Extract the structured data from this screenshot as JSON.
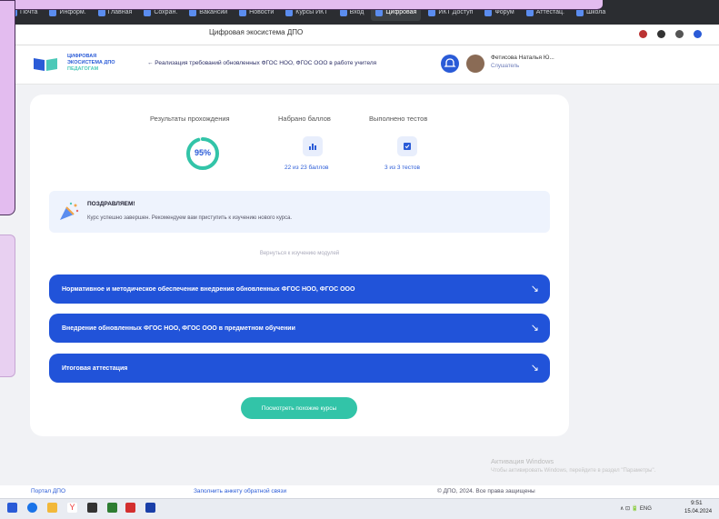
{
  "browser": {
    "tabs": [
      {
        "label": "Почта"
      },
      {
        "label": "Информ."
      },
      {
        "label": "Главная"
      },
      {
        "label": "Сохран."
      },
      {
        "label": "Вакансии"
      },
      {
        "label": "Новости"
      },
      {
        "label": "Курсы ИКТ"
      },
      {
        "label": "Вход"
      },
      {
        "label": "Цифровая",
        "active": true
      },
      {
        "label": "ИКТ Доступ"
      },
      {
        "label": "Форум"
      },
      {
        "label": "Аттестац."
      },
      {
        "label": "Школа"
      }
    ],
    "page_title": "Цифровая экосистема ДПО"
  },
  "header": {
    "logo_line1": "ЦИФРОВАЯ",
    "logo_line2": "ЭКОСИСТЕМА ДПО",
    "logo_line3": "ПЕДАГОГАМ",
    "back_link": "← Реализация требований обновленных ФГОС НОО, ФГОС ООО в работе учителя",
    "user_name": "Фетисова Наталья Ю...",
    "user_role": "Слушатель"
  },
  "results": {
    "col1_label": "Результаты прохождения",
    "col2_label": "Набрано баллов",
    "col3_label": "Выполнено тестов",
    "score_percent": 95,
    "score_text": "95%",
    "points_text": "22 из 23 баллов",
    "tests_text": "3 из 3 тестов"
  },
  "congrats": {
    "title": "ПОЗДРАВЛЯЕМ!",
    "text": "Курс успешно завершен. Рекомендуем вам приступить к изучению нового курса."
  },
  "hint": "Вернуться к изучению модулей",
  "modules": [
    {
      "label": "Нормативное и методическое обеспечение внедрения обновленных ФГОС НОО, ФГОС ООО"
    },
    {
      "label": "Внедрение обновленных ФГОС НОО, ФГОС ООО в предметном обучении"
    },
    {
      "label": "Итоговая аттестация"
    }
  ],
  "cta_label": "Посмотреть похожие курсы",
  "watermark": {
    "line1": "Активация Windows",
    "line2": "Чтобы активировать Windows, перейдите в раздел \"Параметры\"."
  },
  "footer": {
    "portal": "Портал ДПО",
    "feedback": "Заполнить анкету обратной связи",
    "copyright": "© ДПО, 2024. Все права защищены"
  },
  "taskbar": {
    "time": "9:51",
    "date": "15.04.2024",
    "tray": "∧ ⊡ 🔋 ENG"
  },
  "colors": {
    "primary": "#2153d9",
    "accent": "#32c4a8",
    "overlay": "#e3bcef"
  }
}
